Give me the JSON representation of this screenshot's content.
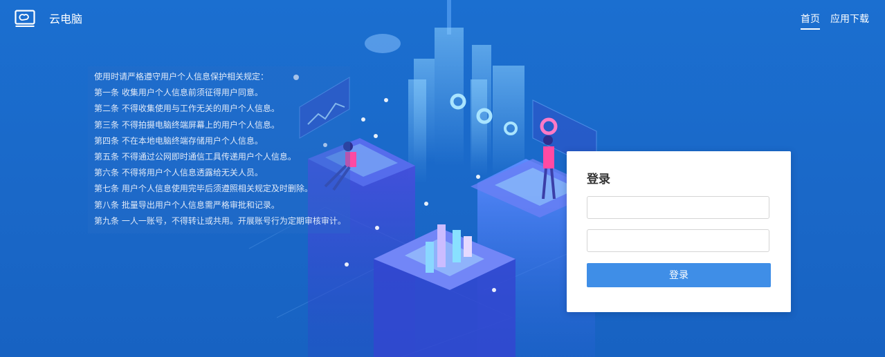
{
  "header": {
    "brand": "云电脑",
    "nav": [
      {
        "label": "首页",
        "active": true
      },
      {
        "label": "应用下载",
        "active": false
      }
    ]
  },
  "rules": {
    "lines": [
      "使用时请严格遵守用户个人信息保护相关规定：",
      "第一条 收集用户个人信息前须征得用户同意。",
      "第二条 不得收集使用与工作无关的用户个人信息。",
      "第三条 不得拍摄电脑终端屏幕上的用户个人信息。",
      "第四条 不在本地电脑终端存储用户个人信息。",
      "第五条 不得通过公网即时通信工具传递用户个人信息。",
      "第六条 不得将用户个人信息透露给无关人员。",
      "第七条 用户个人信息使用完毕后须遵照相关规定及时删除。",
      "第八条 批量导出用户个人信息需严格审批和记录。",
      "第九条 一人一账号，不得转让或共用。开展账号行为定期审核审计。"
    ]
  },
  "login": {
    "title": "登录",
    "username_value": "",
    "password_value": "",
    "button_label": "登录"
  },
  "colors": {
    "background": "#1b6fd0",
    "button": "#3f8ee7",
    "card": "#ffffff"
  },
  "icons": {
    "logo": "cloud-monitor-icon"
  }
}
